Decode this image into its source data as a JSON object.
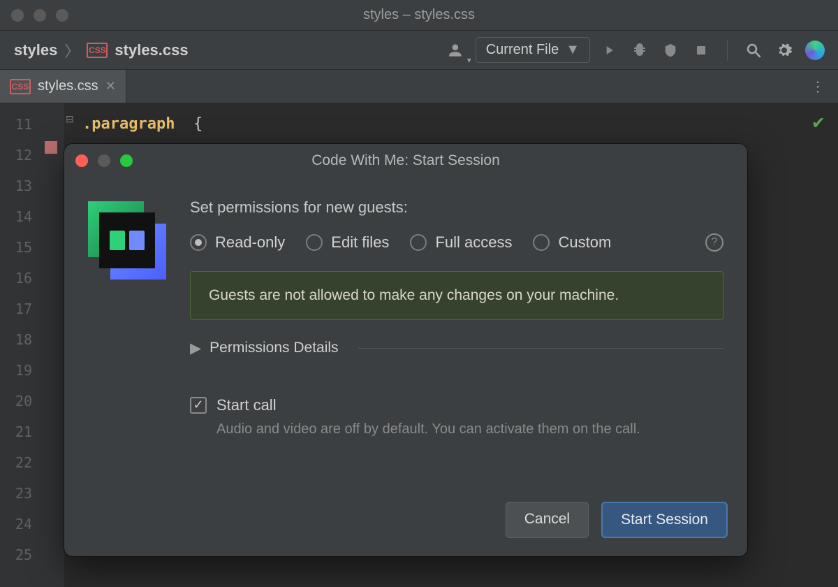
{
  "window": {
    "title": "styles – styles.css"
  },
  "breadcrumbs": {
    "project": "styles",
    "file": "styles.css",
    "file_badge": "CSS"
  },
  "toolbar": {
    "run_config": "Current File"
  },
  "filetab": {
    "label": "styles.css",
    "badge": "CSS"
  },
  "editor": {
    "line_start": 11,
    "line_end": 25,
    "code_line_1": ".paragraph  {"
  },
  "modal": {
    "title": "Code With Me: Start Session",
    "perm_label": "Set permissions for new guests:",
    "radios": {
      "readonly": "Read-only",
      "edit": "Edit files",
      "full": "Full access",
      "custom": "Custom"
    },
    "info": "Guests are not allowed to make any changes on your machine.",
    "disclosure": "Permissions Details",
    "start_call": "Start call",
    "start_call_sub": "Audio and video are off by default. You can activate them on the call.",
    "cancel": "Cancel",
    "start": "Start Session"
  }
}
